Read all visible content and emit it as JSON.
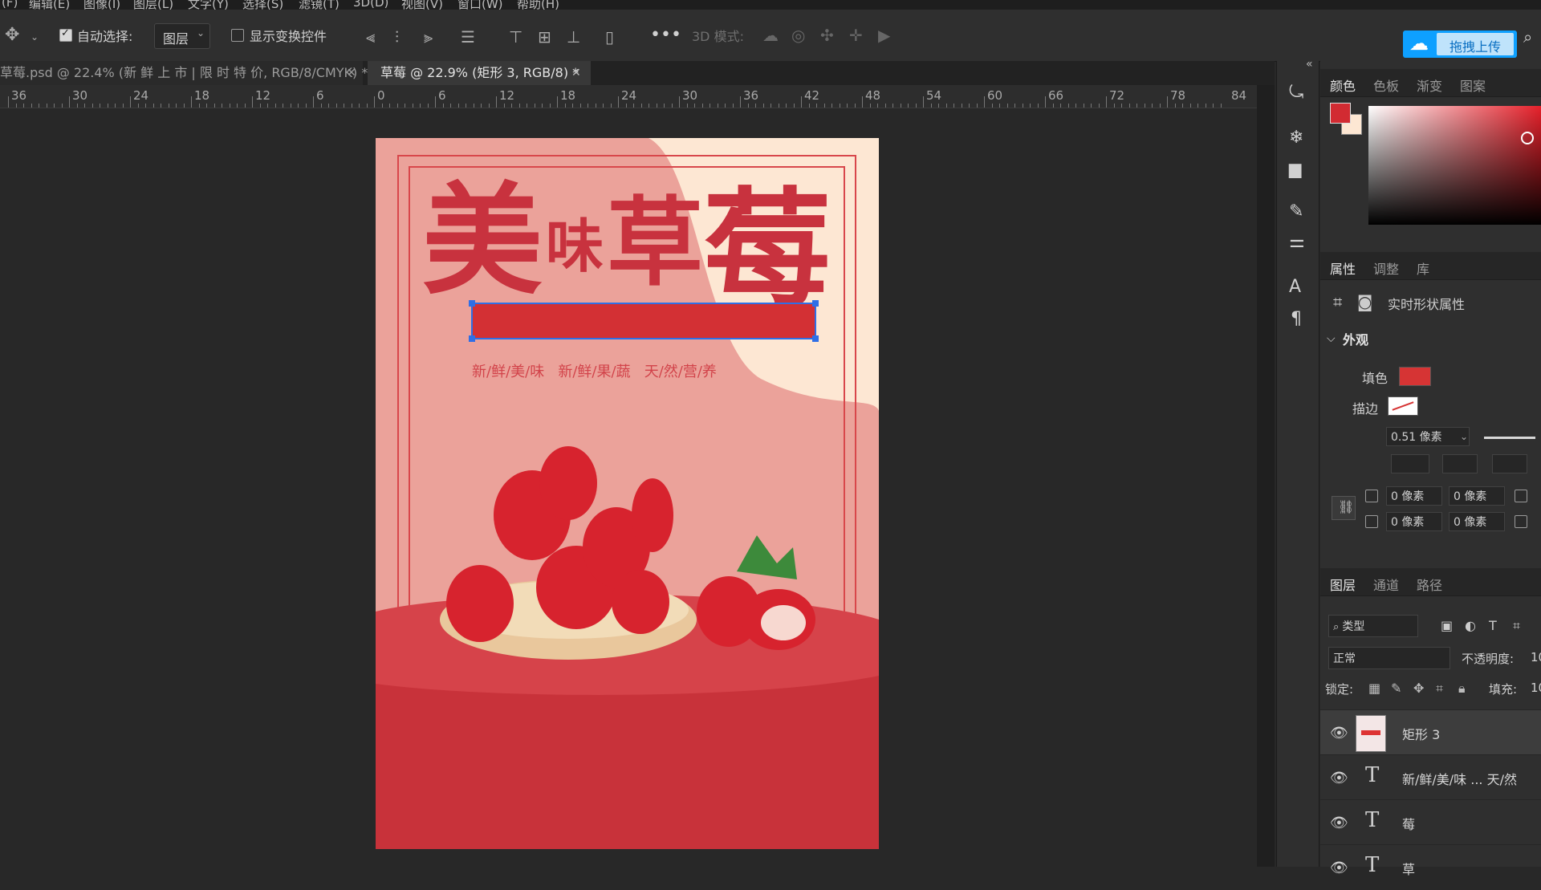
{
  "menu": {
    "items": [
      "(F)",
      "编辑(E)",
      "图像(I)",
      "图层(L)",
      "文字(Y)",
      "选择(S)",
      "滤镜(T)",
      "3D(D)",
      "视图(V)",
      "窗口(W)",
      "帮助(H)"
    ]
  },
  "options": {
    "auto_select_label": "自动选择:",
    "auto_select_checked": true,
    "auto_select_target": "图层",
    "show_transform_label": "显示变换控件",
    "show_transform_checked": false,
    "mode_3d_label": "3D 模式:",
    "upload_button": "拖拽上传"
  },
  "tabs": [
    {
      "label": "草莓.psd @ 22.4% (新 鲜 上 市 | 限 时 特 价, RGB/8/CMYK) *",
      "active": false
    },
    {
      "label": "草莓 @ 22.9% (矩形 3, RGB/8) *",
      "active": true
    }
  ],
  "ruler": {
    "ticks": [
      "36",
      "30",
      "24",
      "18",
      "12",
      "6",
      "0",
      "6",
      "12",
      "18",
      "24",
      "30",
      "36",
      "42",
      "48",
      "54",
      "60",
      "66",
      "72",
      "78",
      "84"
    ]
  },
  "poster": {
    "title_chars": [
      "美",
      "味",
      "草",
      "莓"
    ],
    "tagline": "新/鲜/美/味   新/鲜/果/蔬   天/然/营/养"
  },
  "color_panel": {
    "tabs": [
      "颜色",
      "色板",
      "渐变",
      "图案"
    ],
    "foreground": "#d22b32",
    "background": "#fde7d3"
  },
  "properties_panel": {
    "tabs": [
      "属性",
      "调整",
      "库"
    ],
    "header": "实时形状属性",
    "section": "外观",
    "fill_label": "填色",
    "fill_color": "#d63434",
    "stroke_label": "描边",
    "stroke_width": "0.51 像素",
    "corner_values": [
      "0 像素",
      "0 像素",
      "0 像素",
      "0 像素"
    ]
  },
  "layers_panel": {
    "tabs": [
      "图层",
      "通道",
      "路径"
    ],
    "filter_label": "类型",
    "blend_mode": "正常",
    "opacity_label": "不透明度:",
    "opacity_value": "10",
    "lock_label": "锁定:",
    "fill_label": "填充:",
    "fill_value": "10",
    "layers": [
      {
        "name": "矩形 3",
        "type": "shape",
        "selected": true
      },
      {
        "name": "新/鲜/美/味 ... 天/然",
        "type": "text",
        "selected": false
      },
      {
        "name": "莓",
        "type": "text",
        "selected": false
      },
      {
        "name": "草",
        "type": "text",
        "selected": false
      }
    ]
  }
}
